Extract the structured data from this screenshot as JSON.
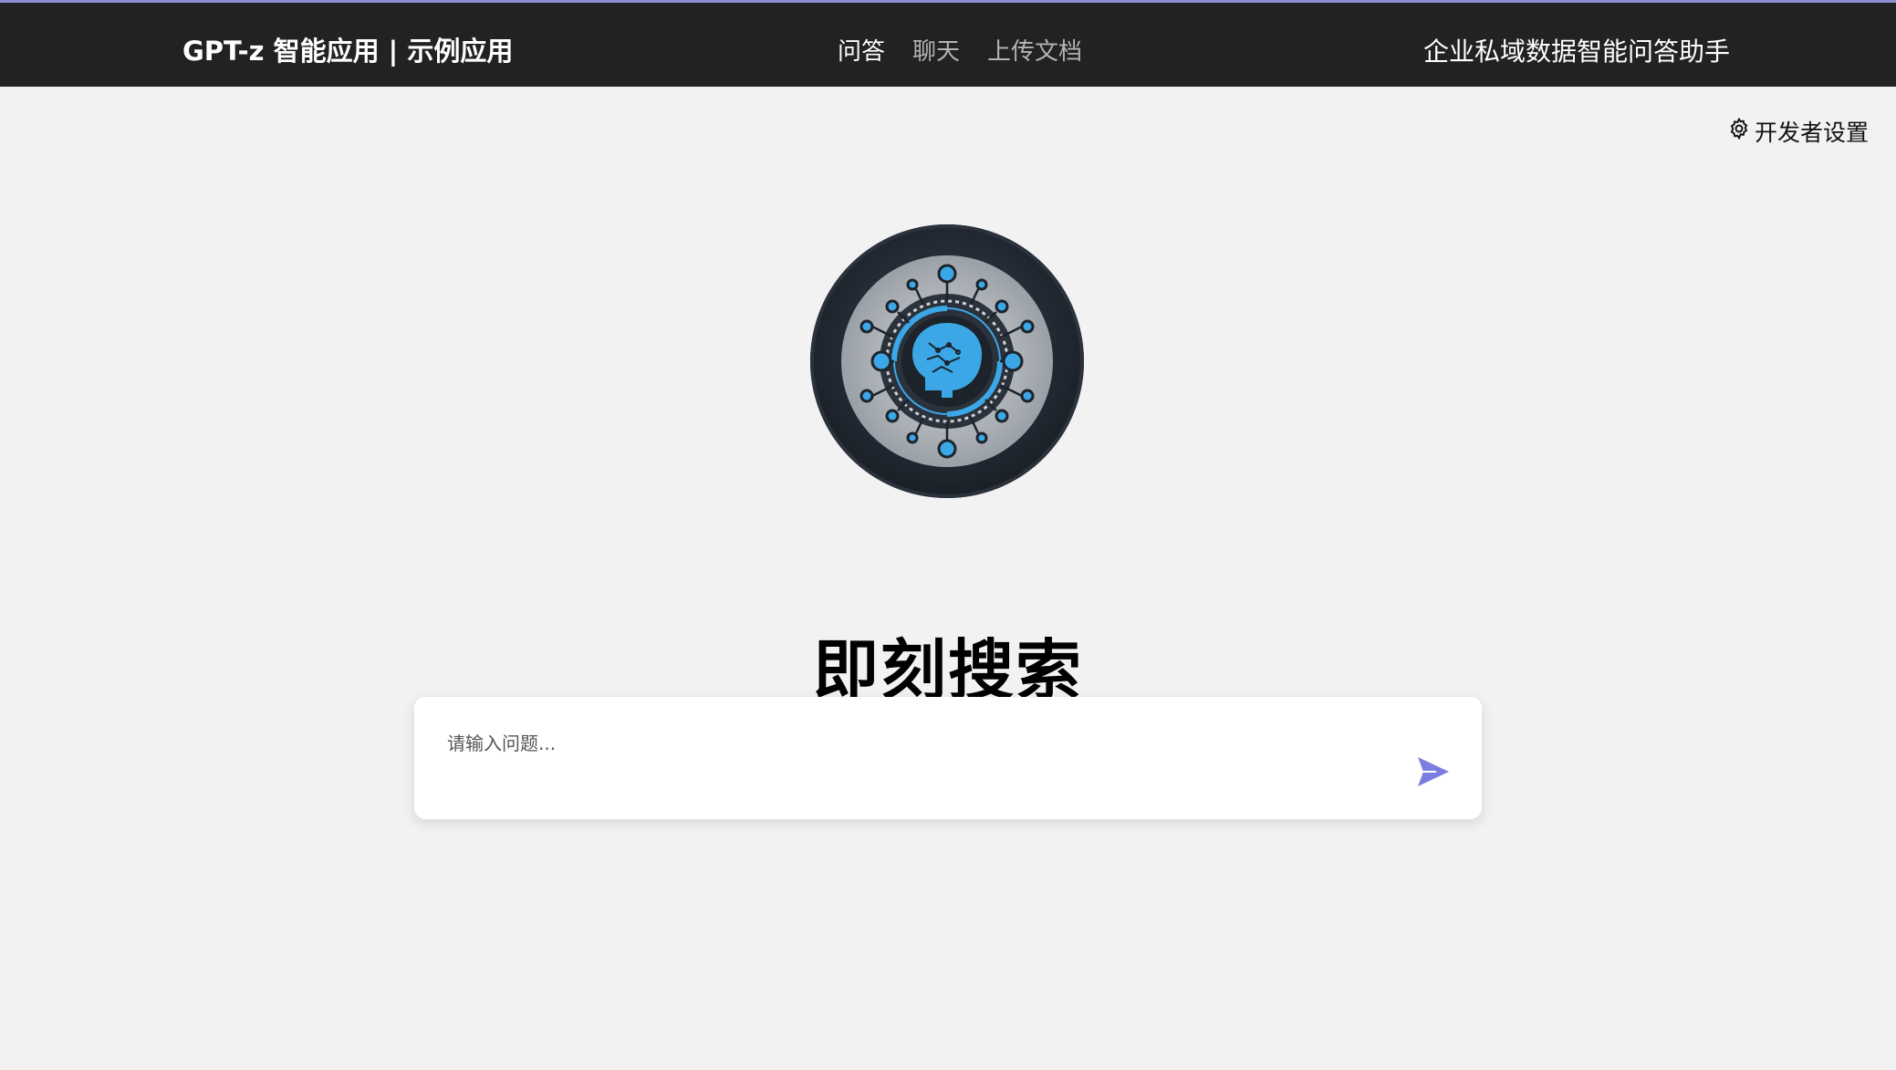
{
  "header": {
    "brand": "GPT-z 智能应用 | 示例应用",
    "nav": [
      {
        "label": "问答",
        "active": true
      },
      {
        "label": "聊天",
        "active": false
      },
      {
        "label": "上传文档",
        "active": false
      }
    ],
    "right_title": "企业私域数据智能问答助手"
  },
  "settings": {
    "label": "开发者设置",
    "icon": "gear-icon"
  },
  "logo": {
    "icon": "ai-brain-circuit-logo"
  },
  "hero": {
    "title": "即刻搜索"
  },
  "search": {
    "placeholder": "请输入问题...",
    "value": "",
    "send_icon": "send-icon"
  },
  "colors": {
    "header_bg": "#222222",
    "page_bg": "#f2f2f2",
    "accent": "#7b7ee0",
    "logo_blue": "#3ba7e6"
  }
}
